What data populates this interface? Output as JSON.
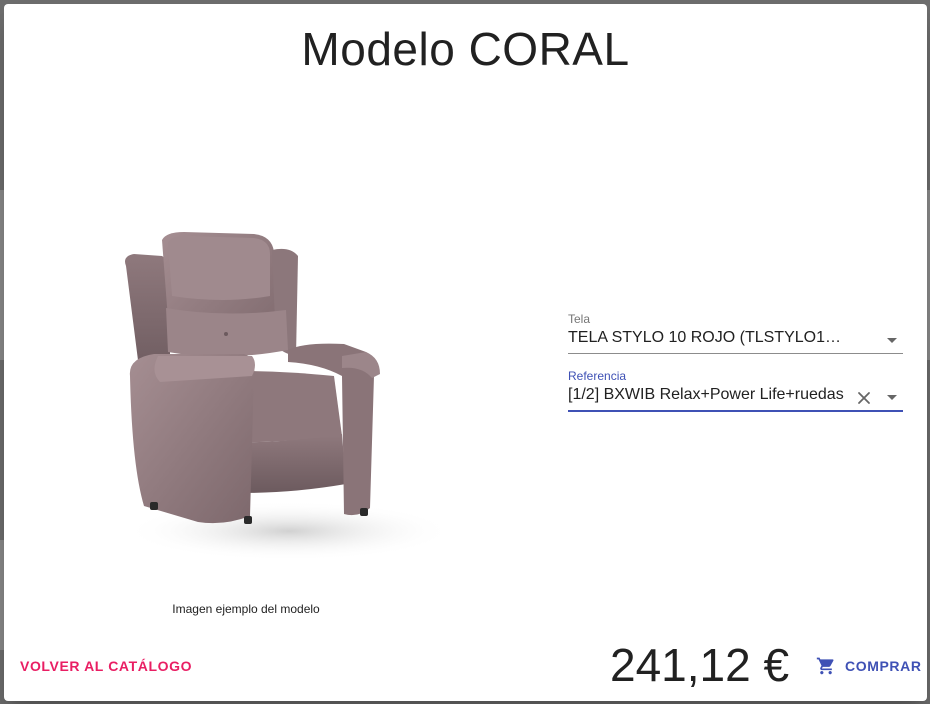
{
  "dialog": {
    "title": "Modelo CORAL",
    "image_caption": "Imagen ejemplo del modelo",
    "fields": {
      "tela": {
        "label": "Tela",
        "value": "TELA STYLO 10 ROJO (TLSTYLO10R..."
      },
      "referencia": {
        "label": "Referencia",
        "value": "[1/2] BXWIB Relax+Power Life+ruedas"
      }
    },
    "price": "241,12 €",
    "back_button_label": "VOLVER AL CATÁLOGO",
    "buy_button_label": "COMPRAR"
  },
  "colors": {
    "accent": "#e91e63",
    "primary": "#3f51b5",
    "text": "#212121",
    "overlay": "#6e6e6e"
  },
  "icons": {
    "product": "armchair-image",
    "dropdown": "arrow-drop-down-icon",
    "clear": "close-icon",
    "cart": "shopping-cart-icon"
  }
}
